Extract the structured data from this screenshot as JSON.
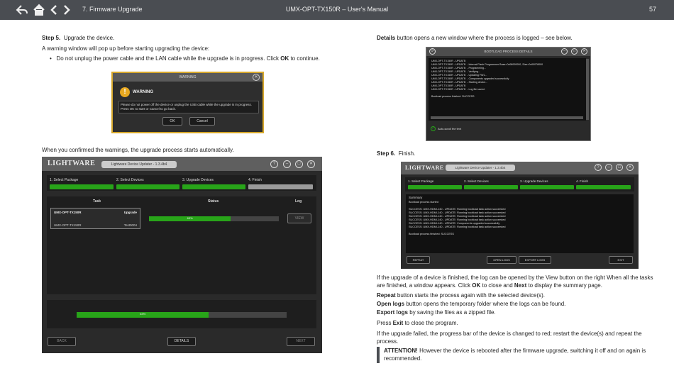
{
  "header": {
    "chapter": "7. Firmware Upgrade",
    "manual_title": "UMX-OPT-TX150R – User's Manual",
    "page_number": "57"
  },
  "left": {
    "step5_num": "Step 5.",
    "step5_text": "Upgrade the device.",
    "warn_intro": "A warning window will pop up before starting upgrading the device:",
    "bullet_a": "Do not unplug the power cable and the LAN cable while the upgrade is in progress. Click ",
    "bullet_ok": "OK",
    "bullet_b": " to continue.",
    "confirm_text": "When you confirmed the warnings, the upgrade process starts automatically."
  },
  "warning_dialog": {
    "title": "WARNING",
    "heading": "WARNING",
    "message": "Please do not power off the device or unplug the USB cable while the upgrade is in progress. Press OK to start or Cancel to go back.",
    "ok": "OK",
    "cancel": "Cancel"
  },
  "updater": {
    "logo": "LIGHTWARE",
    "version": "Lightware Device Updater - 1.3.4b4",
    "steps": [
      "1. Select Package",
      "2. Select Devices",
      "3. Upgrade Devices",
      "4. Finish"
    ],
    "col_task": "Task",
    "col_status": "Status",
    "col_log": "Log",
    "task_name": "UMX-OPT-TX150R",
    "task_type": "Upgrade",
    "task_device": "UMX-OPT-TX150R",
    "task_id": "Test0004",
    "task_progress_label": "63%",
    "task_progress": 0.63,
    "view": "VIEW",
    "overall_progress_label": "63%",
    "overall_progress": 0.63,
    "back": "BACK",
    "details": "DETAILS",
    "next": "NEXT"
  },
  "right": {
    "details_b": "Details",
    "details_text": " button opens a new window where the process is logged – see below.",
    "step6_num": "Step 6.",
    "step6_text": "Finish.",
    "p1": "If the upgrade of a device is finished, the log can be opened by the View button on the right When all the tasks are finished, a window appears. Click ",
    "p1_ok": "OK",
    "p1_mid": " to close and ",
    "p1_next": "Next",
    "p1_end": " to display the summary page.",
    "repeat_b": "Repeat",
    "repeat_t": " button starts the process again with the selected device(s).",
    "open_b": "Open logs",
    "open_t": " button opens the temporary folder where the logs can be found.",
    "export_b": "Export logs",
    "export_t": " by saving the files as a zipped file.",
    "exit_a": "Press ",
    "exit_b": "Exit",
    "exit_t": " to close the program.",
    "failed": "If the upgrade failed, the progress bar of the device is changed to red; restart the device(s) and repeat the process.",
    "att_b": "ATTENTION!",
    "att_t": " However the device is rebooted after the firmware upgrade, switching it off and on again is recommended."
  },
  "bootload": {
    "title": "BOOTLOAD PROCESS DETAILS",
    "lines": [
      "UMX-OPT-TX150R - UPDATE:",
      "UMX-OPT-TX150R - UPDATE: - Internal Flash Programmer Base=0x08000000, Size=0x00078000",
      "UMX-OPT-TX150R - UPDATE: - Programming...",
      "UMX-OPT-TX150R - UPDATE: - Verifying...",
      "UMX-OPT-TX150R - UPDATE: - Updating FW1...",
      "UMX-OPT-TX150R - UPDATE: - Components upgraded successfully",
      "UMX-OPT-TX150R - UPDATE: - Starting device...",
      "UMX-OPT-TX150R - UPDATE:",
      "UMX-OPT-TX150R - UPDATE: - Log file saved.",
      "",
      "Bootload process finished: SUCCESS"
    ],
    "autoscroll": "Auto-scroll the text"
  },
  "finish": {
    "logo": "LIGHTWARE",
    "version": "Lightware Device Updater - 1.3.4b4",
    "summary": "Summary",
    "lines": [
      "Bootload process started",
      "",
      "SUCCESS: UMX-HDMI-140 - UPDATE: Running bootload task action succeeded",
      "SUCCESS: UMX-HDMI-140 - UPDATE: Running bootload task action succeeded",
      "SUCCESS: UMX-HDMI-140 - UPDATE: Running bootload task action succeeded",
      "SUCCESS: UMX-HDMI-140 - UPDATE: Running bootload task action succeeded",
      "SUCCESS: UMX-HDMI-140 - UPDATE: Components upgraded successfully",
      "SUCCESS: UMX-HDMI-140 - UPDATE: Running bootload task action succeeded",
      "",
      "Bootload process finished: SUCCESS"
    ],
    "repeat": "REPEAT",
    "open_logs": "OPEN LOGS",
    "export_logs": "EXPORT LOGS",
    "exit": "EXIT"
  }
}
